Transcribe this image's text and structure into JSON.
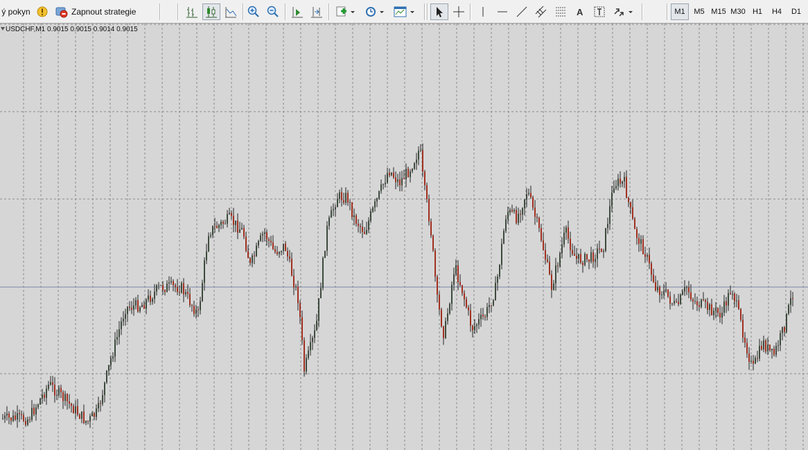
{
  "toolbar": {
    "new_order_label": "ý pokyn",
    "strategy_label": "Zapnout strategie",
    "timeframes": [
      "M1",
      "M5",
      "M15",
      "M30",
      "H1",
      "H4",
      "D1"
    ],
    "active_timeframe": "M1",
    "icons": [
      "alert-icon",
      "strategy-icon",
      "bar-chart-icon",
      "candle-chart-icon",
      "line-chart-icon",
      "zoom-in-icon",
      "zoom-out-icon",
      "chart-shift-icon",
      "autoscroll-icon",
      "new-indicator-icon",
      "periods-icon",
      "templates-icon",
      "cursor-icon",
      "crosshair-icon",
      "vertical-line-icon",
      "horizontal-line-icon",
      "trend-line-icon",
      "equidistant-channel-icon",
      "fibonacci-icon",
      "text-icon",
      "text-label-icon",
      "arrows-icon"
    ]
  },
  "chart": {
    "symbol_info": "USDCHF,M1  0.9015 0.9015 0.9014 0.9015",
    "bull_color": "#3d4a3d",
    "bear_color": "#a03020",
    "grid_color": "#8a8a8a",
    "bid_line_color": "#7a8aa8",
    "background": "#d6d6d6"
  }
}
